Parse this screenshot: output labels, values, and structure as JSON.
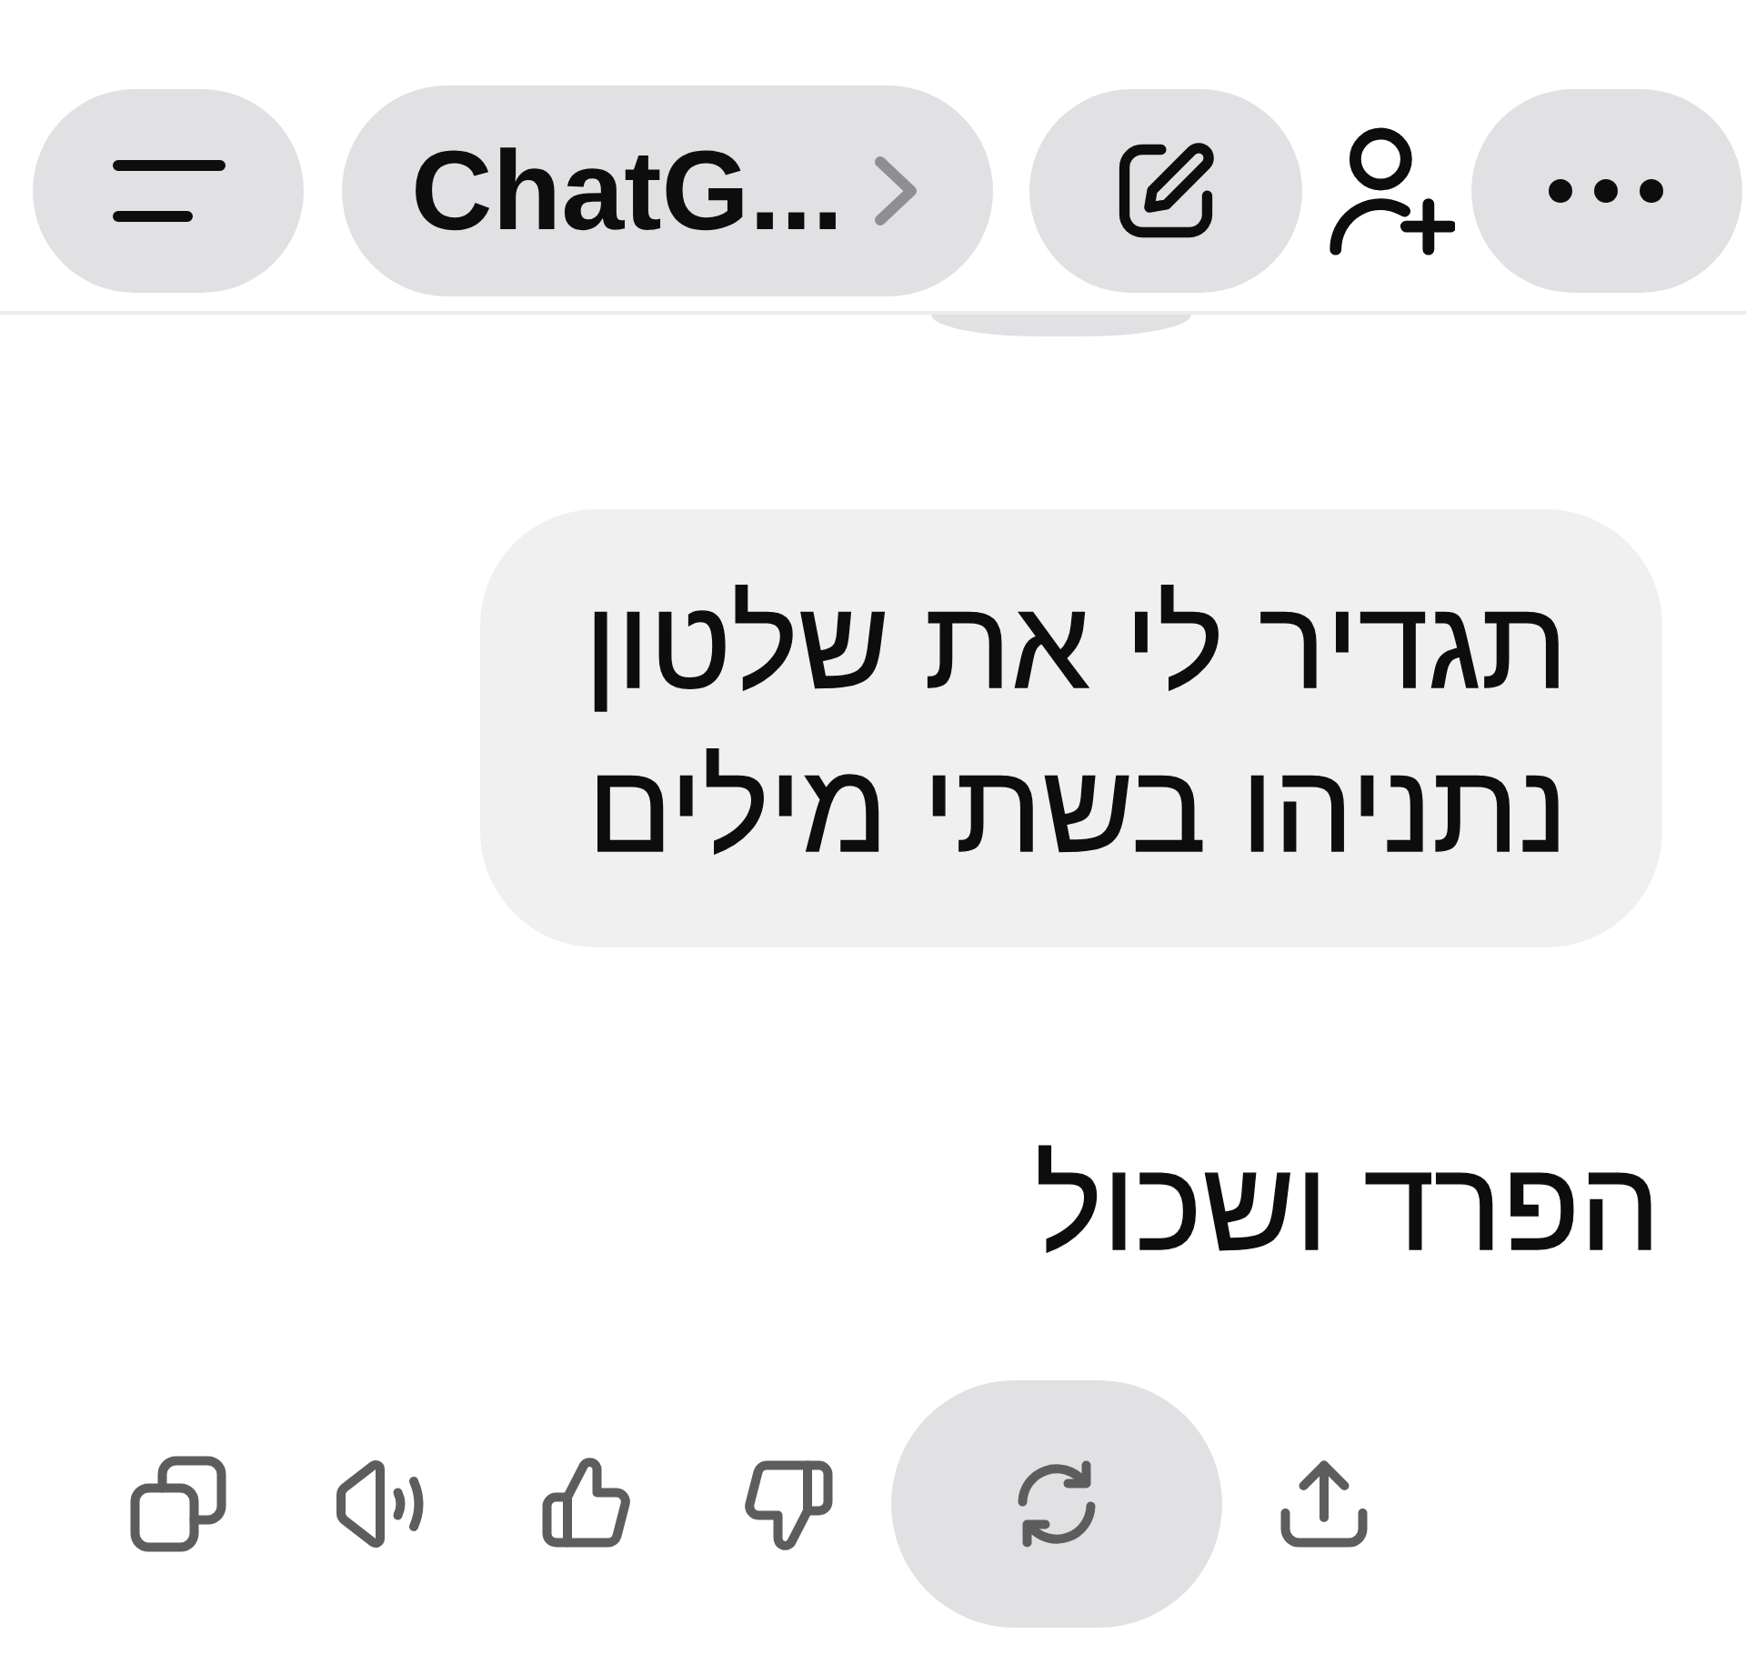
{
  "header": {
    "title": "ChatG..."
  },
  "messages": [
    {
      "kind": "user",
      "text": "תגדיר לי את שלטון נתניהו בשתי מילים"
    },
    {
      "kind": "assistant",
      "text": "הפרד ושכול"
    }
  ],
  "actions": [
    {
      "pressed": false
    },
    {
      "pressed": false
    },
    {
      "pressed": false
    },
    {
      "pressed": false
    },
    {
      "pressed": true
    },
    {
      "pressed": false
    }
  ]
}
